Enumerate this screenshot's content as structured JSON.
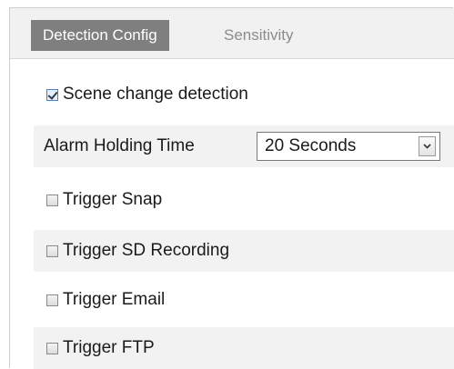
{
  "tabs": {
    "detection_config": "Detection Config",
    "sensitivity": "Sensitivity"
  },
  "scene_change": {
    "label": "Scene change detection",
    "checked": true
  },
  "alarm_holding": {
    "label": "Alarm Holding Time",
    "selected": "20 Seconds"
  },
  "triggers": {
    "snap": {
      "label": "Trigger Snap",
      "checked": false
    },
    "sd_recording": {
      "label": "Trigger SD Recording",
      "checked": false
    },
    "email": {
      "label": "Trigger Email",
      "checked": false
    },
    "ftp": {
      "label": "Trigger FTP",
      "checked": false
    }
  },
  "icons": {
    "dropdown": "chevron-down-icon",
    "checkbox_checked": "checkbox-checked-icon",
    "checkbox_unchecked": "checkbox-unchecked-icon"
  },
  "colors": {
    "active_tab_bg": "#7f7f7f",
    "active_tab_text": "#ffffff",
    "inactive_tab_text": "#8c8c8c",
    "shaded_row_bg": "#f2f2f2"
  }
}
